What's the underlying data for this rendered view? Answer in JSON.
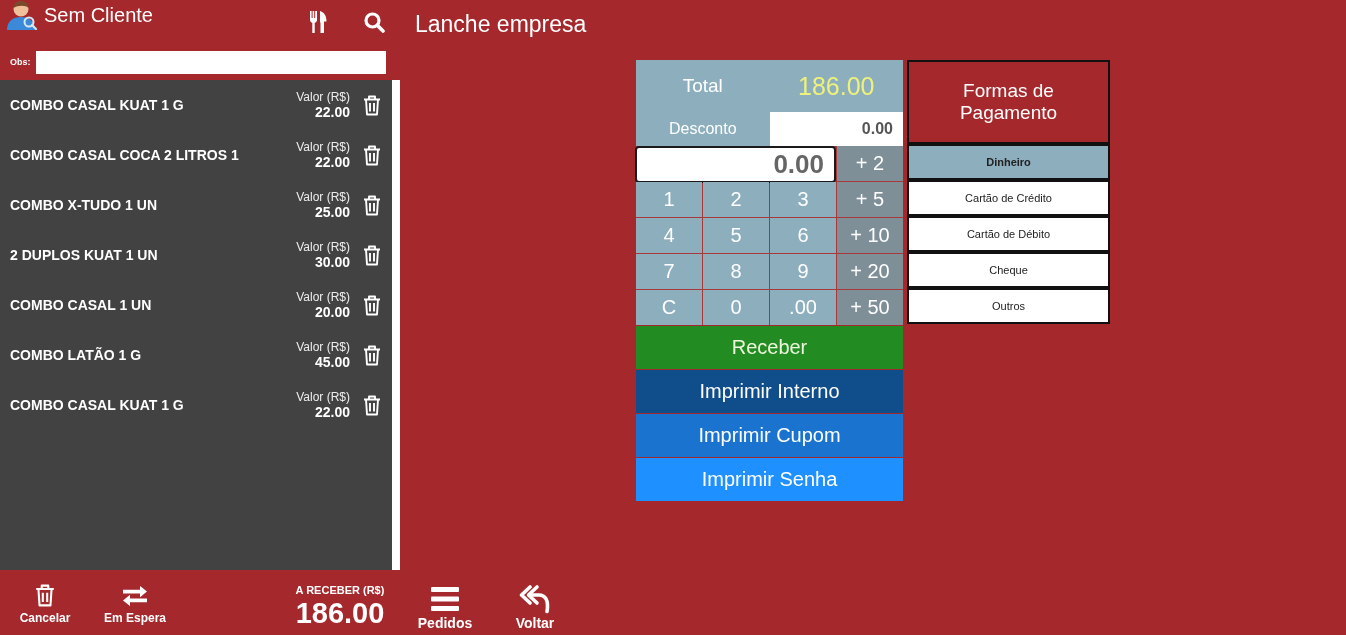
{
  "left_panel": {
    "customer": "Sem Cliente",
    "obs": {
      "label": "Obs:"
    }
  },
  "order_items": [
    {
      "name": "COMBO CASAL KUAT 1 G",
      "price_label": "Valor (R$)",
      "price": "22.00"
    },
    {
      "name": "COMBO CASAL COCA 2 LITROS 1",
      "price_label": "Valor (R$)",
      "price": "22.00"
    },
    {
      "name": "COMBO X-TUDO 1 UN",
      "price_label": "Valor (R$)",
      "price": "25.00"
    },
    {
      "name": "2 DUPLOS KUAT 1 UN",
      "price_label": "Valor (R$)",
      "price": "30.00"
    },
    {
      "name": "COMBO CASAL 1 UN",
      "price_label": "Valor (R$)",
      "price": "20.00"
    },
    {
      "name": "COMBO LATÃO 1 G",
      "price_label": "Valor (R$)",
      "price": "45.00"
    },
    {
      "name": "COMBO CASAL KUAT 1 G",
      "price_label": "Valor (R$)",
      "price": "22.00"
    }
  ],
  "footer": {
    "actions": [
      {
        "kind": "cancel",
        "label": "Cancelar"
      },
      {
        "kind": "hold",
        "label": "Em Espera"
      }
    ],
    "amount_due": {
      "label": "A RECEBER (R$)",
      "value": "186.00"
    },
    "nav": [
      {
        "kind": "orders",
        "label": "Pedidos"
      },
      {
        "kind": "back",
        "label": "Voltar"
      }
    ]
  },
  "page_title": "Lanche empresa",
  "summary": {
    "total_label": "Total",
    "total": "186.00",
    "discount_label": "Desconto",
    "discount": "0.00"
  },
  "keypad": {
    "display": "0.00",
    "keys": [
      {
        "kind": "add",
        "label": "+ 2"
      },
      {
        "kind": "digit",
        "label": "1"
      },
      {
        "kind": "digit",
        "label": "2"
      },
      {
        "kind": "digit",
        "label": "3"
      },
      {
        "kind": "add",
        "label": "+ 5"
      },
      {
        "kind": "digit",
        "label": "4"
      },
      {
        "kind": "digit",
        "label": "5"
      },
      {
        "kind": "digit",
        "label": "6"
      },
      {
        "kind": "add",
        "label": "+ 10"
      },
      {
        "kind": "digit",
        "label": "7"
      },
      {
        "kind": "digit",
        "label": "8"
      },
      {
        "kind": "digit",
        "label": "9"
      },
      {
        "kind": "add",
        "label": "+ 20"
      },
      {
        "kind": "clear",
        "label": "C"
      },
      {
        "kind": "digit",
        "label": "0"
      },
      {
        "kind": "digit",
        "label": ".00"
      },
      {
        "kind": "add",
        "label": "+ 50"
      }
    ]
  },
  "actions": [
    {
      "kind": "receive",
      "label": "Receber"
    },
    {
      "kind": "print-internal",
      "label": "Imprimir Interno"
    },
    {
      "kind": "print-receipt",
      "label": "Imprimir Cupom"
    },
    {
      "kind": "print-ticket",
      "label": "Imprimir Senha"
    }
  ],
  "payment": {
    "title": "Formas de Pagamento",
    "methods": [
      {
        "label": "Dinheiro",
        "selected": true
      },
      {
        "label": "Cartão de Crédito",
        "selected": false
      },
      {
        "label": "Cartão de Débito",
        "selected": false
      },
      {
        "label": "Cheque",
        "selected": false
      },
      {
        "label": "Outros",
        "selected": false
      }
    ]
  }
}
